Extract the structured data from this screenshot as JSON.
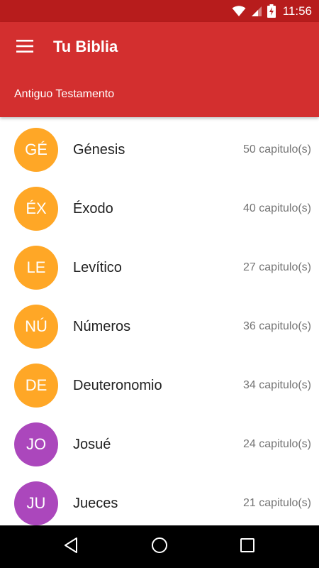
{
  "status_bar": {
    "time": "11:56",
    "icons": [
      "wifi-icon",
      "cell-signal-icon",
      "battery-charging-icon"
    ]
  },
  "app_bar": {
    "title": "Tu Biblia",
    "section_label": "Antiguo Testamento",
    "menu_icon": "hamburger-menu-icon",
    "color": "#d32f2f",
    "status_color": "#b71c1c"
  },
  "books": [
    {
      "abbr": "GÉ",
      "name": "Génesis",
      "chapters": "50 capitulo(s)",
      "color": "#ffa726"
    },
    {
      "abbr": "ÉX",
      "name": "Éxodo",
      "chapters": "40 capitulo(s)",
      "color": "#ffa726"
    },
    {
      "abbr": "LE",
      "name": "Levítico",
      "chapters": "27 capitulo(s)",
      "color": "#ffa726"
    },
    {
      "abbr": "NÚ",
      "name": "Números",
      "chapters": "36 capitulo(s)",
      "color": "#ffa726"
    },
    {
      "abbr": "DE",
      "name": "Deuteronomio",
      "chapters": "34 capitulo(s)",
      "color": "#ffa726"
    },
    {
      "abbr": "JO",
      "name": "Josué",
      "chapters": "24 capitulo(s)",
      "color": "#ab47bc"
    },
    {
      "abbr": "JU",
      "name": "Jueces",
      "chapters": "21 capitulo(s)",
      "color": "#ab47bc"
    }
  ],
  "nav_bar": {
    "icons": [
      "back-icon",
      "home-icon",
      "recents-icon"
    ]
  }
}
